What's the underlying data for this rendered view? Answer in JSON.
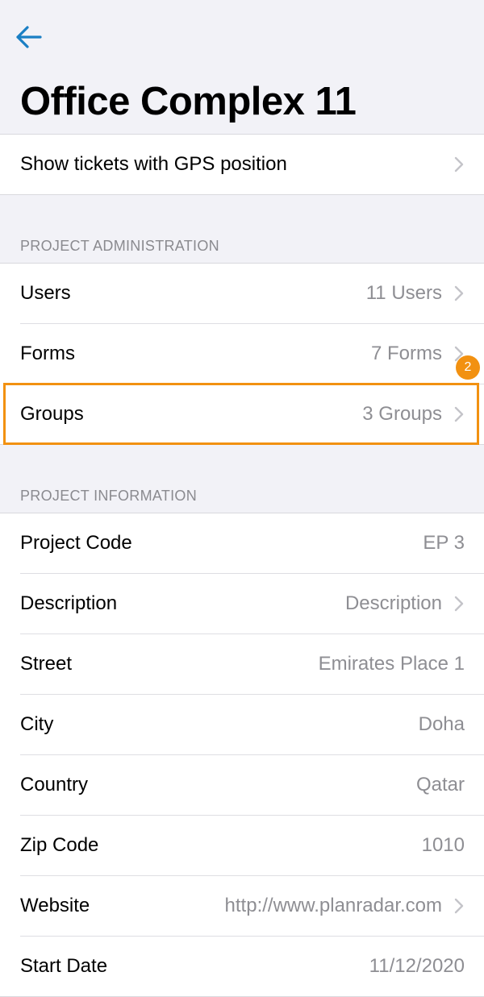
{
  "header": {
    "back_icon": "arrow-left-icon",
    "title": "Office Complex 11"
  },
  "gps_row": {
    "label": "Show tickets with GPS position"
  },
  "admin": {
    "section_title": "PROJECT ADMINISTRATION",
    "rows": [
      {
        "label": "Users",
        "value": "11 Users"
      },
      {
        "label": "Forms",
        "value": "7 Forms"
      },
      {
        "label": "Groups",
        "value": "3 Groups"
      }
    ]
  },
  "info": {
    "section_title": "PROJECT INFORMATION",
    "rows": [
      {
        "label": "Project Code",
        "value": "EP 3"
      },
      {
        "label": "Description",
        "value": "Description"
      },
      {
        "label": "Street",
        "value": "Emirates Place 1"
      },
      {
        "label": "City",
        "value": "Doha"
      },
      {
        "label": "Country",
        "value": "Qatar"
      },
      {
        "label": "Zip Code",
        "value": "1010"
      },
      {
        "label": "Website",
        "value": "http://www.planradar.com"
      },
      {
        "label": "Start Date",
        "value": "11/12/2020"
      }
    ]
  },
  "annotation": {
    "badge": "2",
    "color": "#f29111"
  },
  "colors": {
    "accent": "#1a7fc4",
    "secondary_text": "#8e8e93",
    "background": "#f2f2f7"
  }
}
